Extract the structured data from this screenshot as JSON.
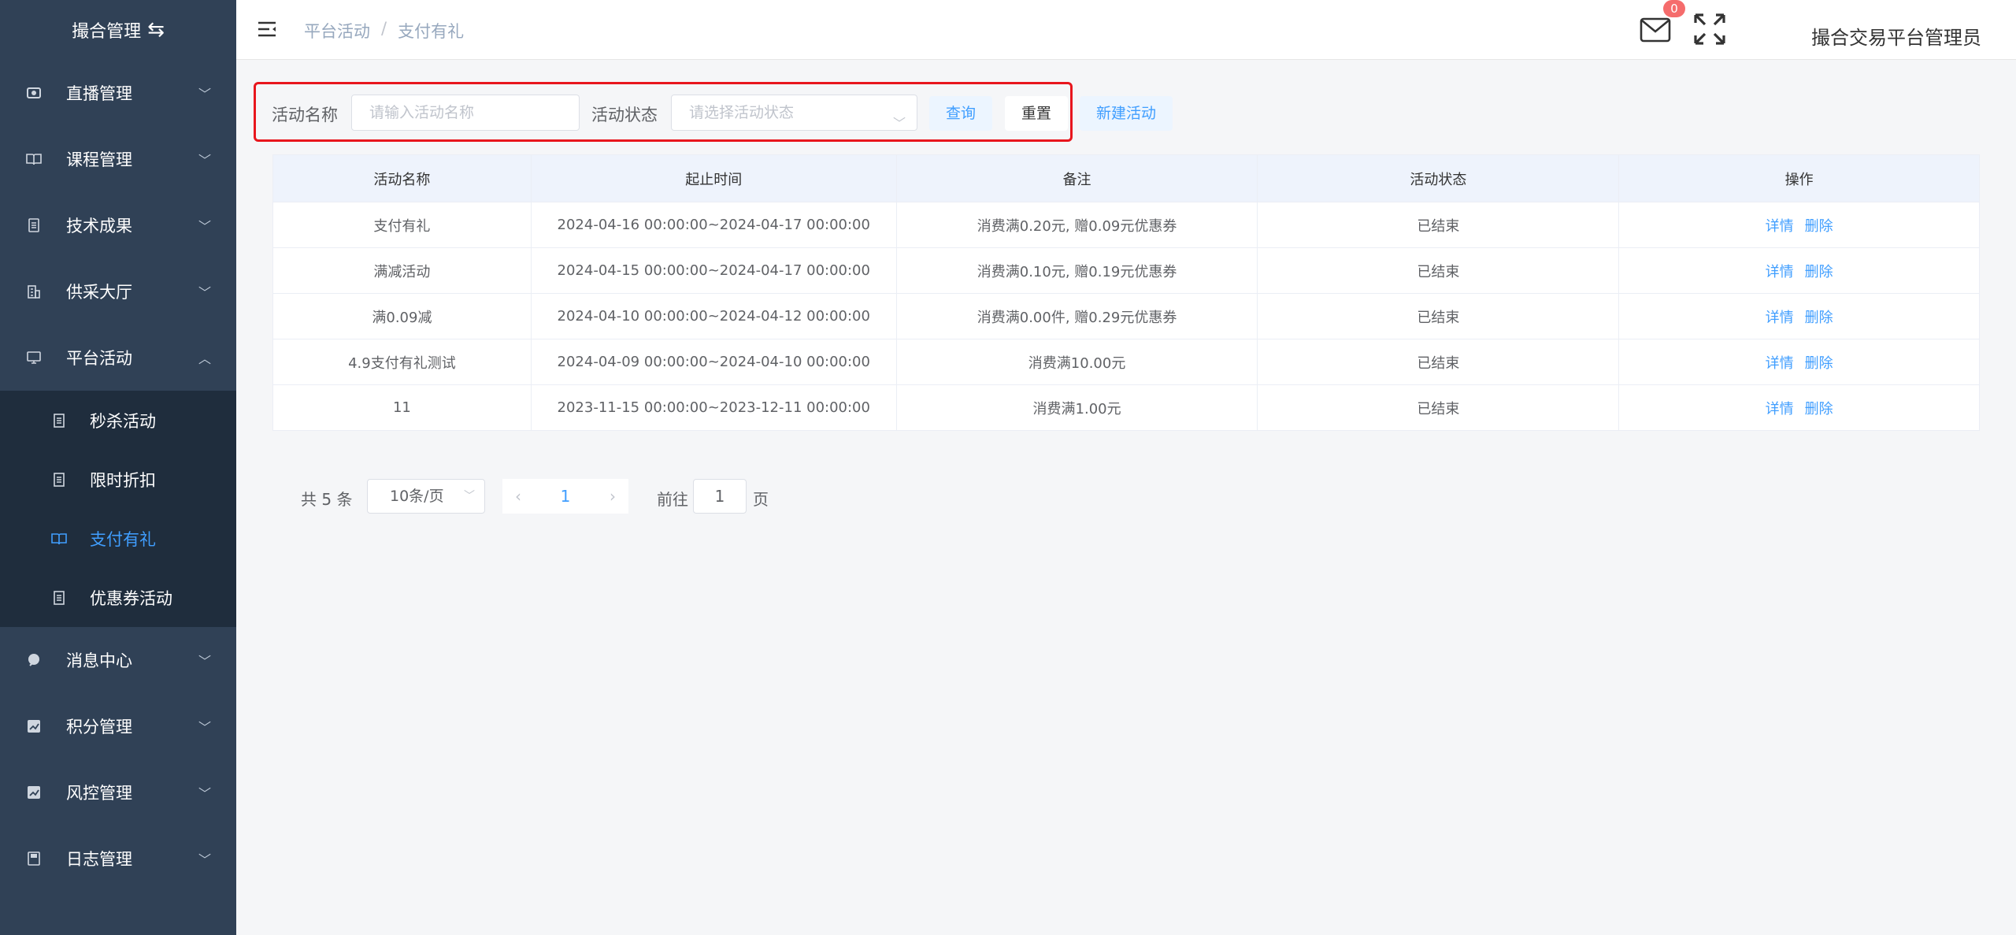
{
  "sidebar": {
    "brand": "撮合管理",
    "menu": [
      {
        "label": "直播管理"
      },
      {
        "label": "课程管理"
      },
      {
        "label": "技术成果"
      },
      {
        "label": "供采大厅"
      },
      {
        "label": "平台活动"
      }
    ],
    "submenu": [
      {
        "label": "秒杀活动"
      },
      {
        "label": "限时折扣"
      },
      {
        "label": "支付有礼"
      },
      {
        "label": "优惠券活动"
      }
    ],
    "menu_bottom": [
      {
        "label": "消息中心"
      },
      {
        "label": "积分管理"
      },
      {
        "label": "风控管理"
      },
      {
        "label": "日志管理"
      }
    ]
  },
  "header": {
    "breadcrumb": [
      "平台活动",
      "/",
      "支付有礼"
    ],
    "notification_count": "0",
    "username": "撮合交易平台管理员"
  },
  "filter": {
    "name_label": "活动名称",
    "name_placeholder": "请输入活动名称",
    "status_label": "活动状态",
    "status_placeholder": "请选择活动状态",
    "query_label": "查询",
    "reset_label": "重置",
    "new_label": "新建活动"
  },
  "table": {
    "headers": [
      "活动名称",
      "起止时间",
      "备注",
      "活动状态",
      "操作"
    ],
    "rows": [
      {
        "name": "支付有礼",
        "time": "2024-04-16 00:00:00~2024-04-17 00:00:00",
        "note": "消费满0.20元, 赠0.09元优惠券",
        "status": "已结束",
        "detail": "详情",
        "delete": "删除"
      },
      {
        "name": "满减活动",
        "time": "2024-04-15 00:00:00~2024-04-17 00:00:00",
        "note": "消费满0.10元, 赠0.19元优惠券",
        "status": "已结束",
        "detail": "详情",
        "delete": "删除"
      },
      {
        "name": "满0.09减",
        "time": "2024-04-10 00:00:00~2024-04-12 00:00:00",
        "note": "消费满0.00件, 赠0.29元优惠券",
        "status": "已结束",
        "detail": "详情",
        "delete": "删除"
      },
      {
        "name": "4.9支付有礼测试",
        "time": "2024-04-09 00:00:00~2024-04-10 00:00:00",
        "note": "消费满10.00元",
        "status": "已结束",
        "detail": "详情",
        "delete": "删除"
      },
      {
        "name": "11",
        "time": "2023-11-15 00:00:00~2023-12-11 00:00:00",
        "note": "消费满1.00元",
        "status": "已结束",
        "detail": "详情",
        "delete": "删除"
      }
    ]
  },
  "pagination": {
    "total": "共 5 条",
    "page_size": "10条/页",
    "current_page": "1",
    "goto_label": "前往",
    "goto_value": "1",
    "page_suffix": "页"
  },
  "colors": {
    "sidebar_bg": "#304156",
    "submenu_bg": "#1f2d3d",
    "accent": "#409eff",
    "highlight_border": "#e8161d",
    "badge": "#f56c6c"
  }
}
